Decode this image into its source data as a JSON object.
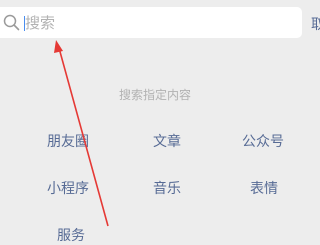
{
  "search": {
    "placeholder": "搜索"
  },
  "cancel_label": "取",
  "section": {
    "title": "搜索指定内容",
    "options": [
      "朋友圈",
      "文章",
      "公众号",
      "小程序",
      "音乐",
      "表情",
      "服务"
    ]
  },
  "colors": {
    "background": "#ededed",
    "link": "#576b95",
    "hint": "#b2b2b2",
    "annotation": "#e53935"
  }
}
